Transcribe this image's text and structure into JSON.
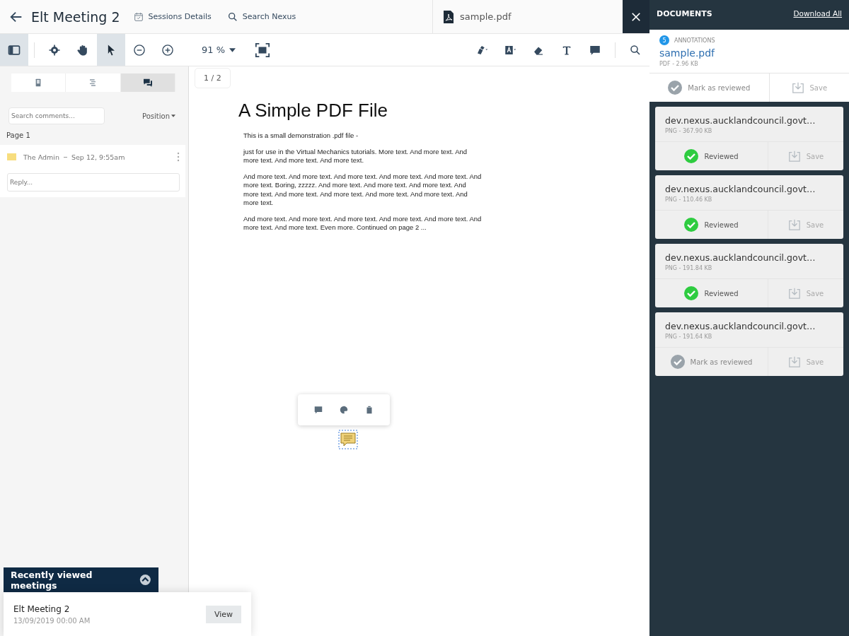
{
  "header": {
    "title": "Elt Meeting 2",
    "links": [
      {
        "kind": "calendar",
        "label": "Sessions Details"
      },
      {
        "kind": "search",
        "label": "Search Nexus"
      }
    ],
    "file_tab": "sample.pdf"
  },
  "toolbar": {
    "left_tools": [
      {
        "kind": "sidebar",
        "selected": true
      },
      {
        "kind": "gear",
        "selected": false
      },
      {
        "kind": "hand",
        "selected": false
      },
      {
        "kind": "pointer",
        "selected": true
      },
      {
        "kind": "zoom-out",
        "selected": false
      },
      {
        "kind": "zoom-in",
        "selected": false
      }
    ],
    "zoom": "91 %",
    "right_tools": [
      {
        "kind": "pen",
        "selected": false
      },
      {
        "kind": "highlight",
        "selected": false
      },
      {
        "kind": "eraser",
        "selected": false
      },
      {
        "kind": "text",
        "selected": false
      },
      {
        "kind": "comment",
        "selected": false
      },
      {
        "kind": "search",
        "selected": false
      }
    ]
  },
  "sidebar": {
    "tabs": [
      {
        "kind": "thumbnails",
        "selected": false
      },
      {
        "kind": "outline",
        "selected": false
      },
      {
        "kind": "comments",
        "selected": true
      }
    ],
    "search": {
      "placeholder": "Search comments..."
    },
    "sort": "Position",
    "page_label": "Page 1",
    "comments": [
      {
        "author": "The Admin",
        "time": "Sep 12, 9:55am",
        "color": "#f7dd7e",
        "reply_placeholder": "Reply..."
      }
    ]
  },
  "recent": {
    "title": "Recently viewed meetings",
    "items": [
      {
        "name": "Elt Meeting 2",
        "date": "13/09/2019 00:00 AM",
        "button": "View"
      }
    ]
  },
  "viewer": {
    "page_counter": "1 / 2",
    "doc_title": "A Simple PDF File",
    "paragraphs": [
      "This is a small demonstration .pdf file -",
      "just for use in the Virtual Mechanics tutorials. More text. And more text. And more text. And more text. And more text.",
      "And more text. And more text. And more text. And more text. And more text. And more text. Boring, zzzzz. And more text. And more text. And more text. And more text. And more text. And more text. And more text. And more text. And more text.",
      "And more text. And more text. And more text. And more text. And more text. And more text. And more text. Even more. Continued on page 2 ..."
    ]
  },
  "documents": {
    "title": "DOCUMENTS",
    "download_all": "Download All",
    "annotations_count": "5",
    "annotations_label": "ANNOTATIONS",
    "main": {
      "name": "sample.pdf",
      "meta": "PDF - 2.96 KB",
      "reviewed": false,
      "review_label": "Mark as reviewed",
      "save": "Save"
    },
    "items": [
      {
        "name": "dev.nexus.aucklandcouncil.govt…",
        "meta": "PNG - 367.90 KB",
        "reviewed": true,
        "review_label": "Reviewed",
        "save": "Save"
      },
      {
        "name": "dev.nexus.aucklandcouncil.govt…",
        "meta": "PNG - 110.46 KB",
        "reviewed": true,
        "review_label": "Reviewed",
        "save": "Save"
      },
      {
        "name": "dev.nexus.aucklandcouncil.govt…",
        "meta": "PNG - 191.84 KB",
        "reviewed": true,
        "review_label": "Reviewed",
        "save": "Save"
      },
      {
        "name": "dev.nexus.aucklandcouncil.govt…",
        "meta": "PNG - 191.64 KB",
        "reviewed": false,
        "review_label": "Mark as reviewed",
        "save": "Save"
      }
    ]
  }
}
